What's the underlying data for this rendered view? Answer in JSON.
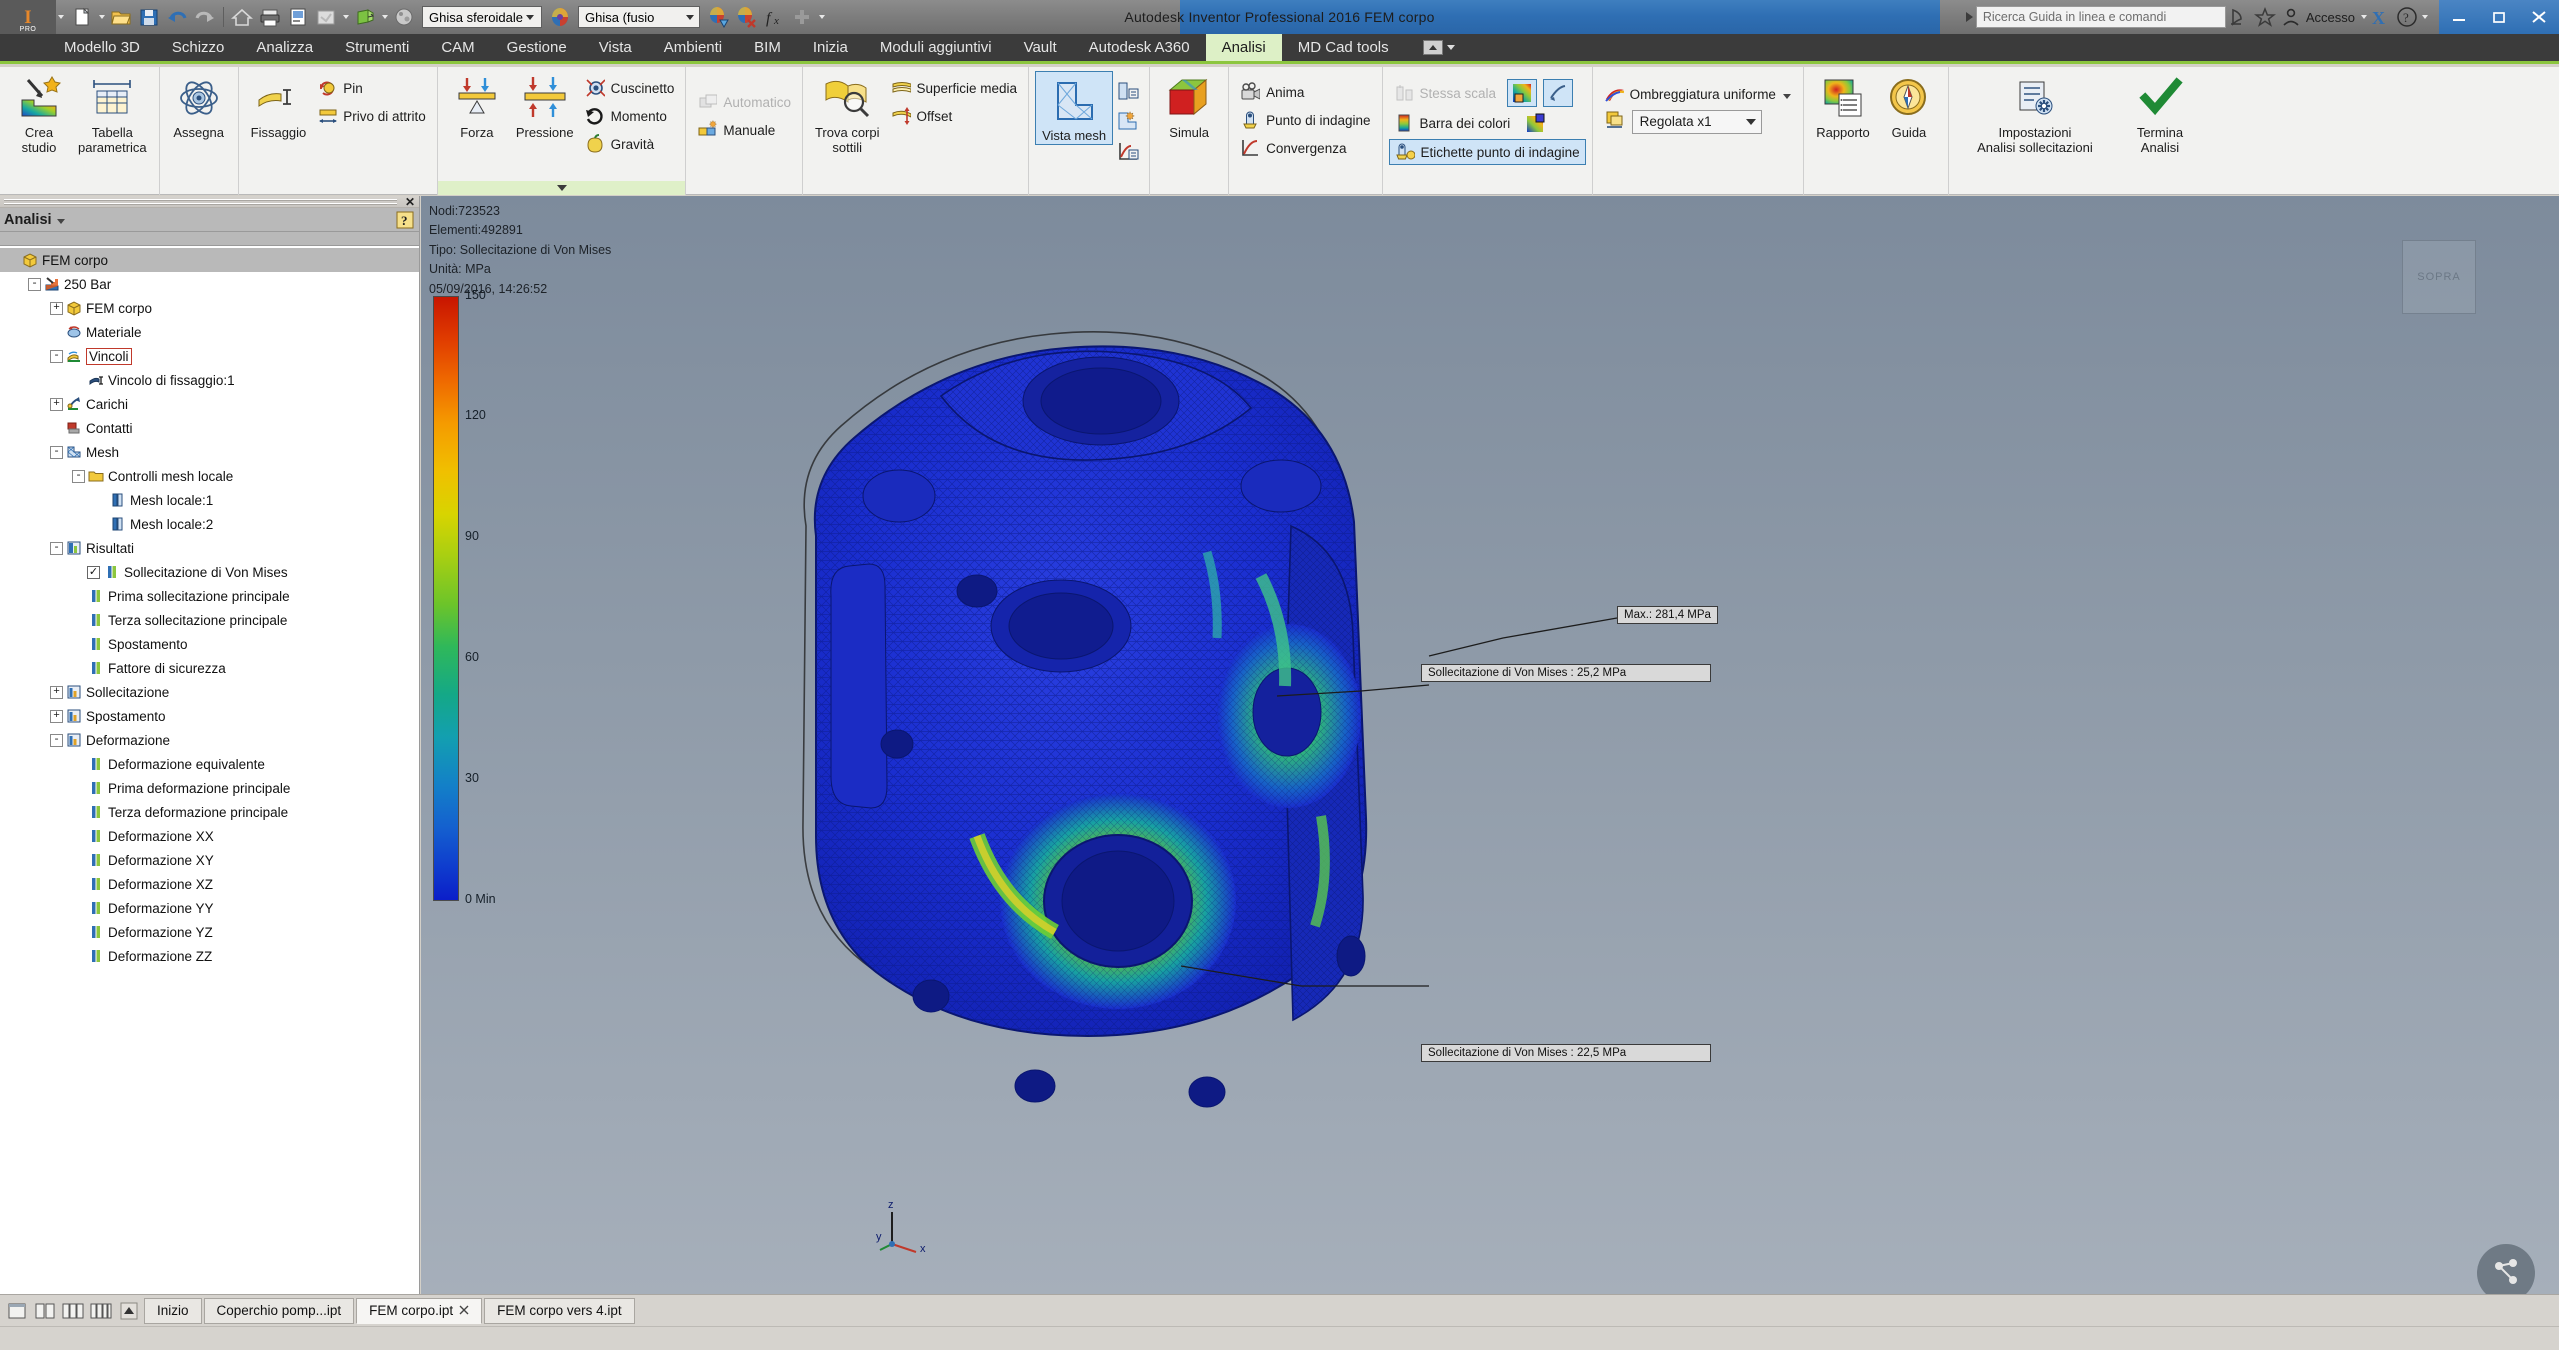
{
  "titlebar": {
    "app_badge": "I",
    "app_badge_sub": "PRO",
    "title": "Autodesk Inventor Professional 2016    FEM corpo",
    "material_combo": "Ghisa sferoidale",
    "appearance_combo": "Ghisa (fusio",
    "search_placeholder": "Ricerca Guida in linea e comandi",
    "account_label": "Accesso",
    "quick_access_icons": [
      "new-document-icon",
      "open-folder-icon",
      "save-icon",
      "undo-icon",
      "redo-icon",
      "home-icon",
      "print-icon",
      "sheet-icon",
      "update-icon",
      "return-icon",
      "material-sphere-icon"
    ],
    "window_buttons": [
      "minimize",
      "restore",
      "close"
    ]
  },
  "ribbon": {
    "tabs": [
      {
        "label": "Modello 3D",
        "active": false
      },
      {
        "label": "Schizzo",
        "active": false
      },
      {
        "label": "Analizza",
        "active": false
      },
      {
        "label": "Strumenti",
        "active": false
      },
      {
        "label": "CAM",
        "active": false
      },
      {
        "label": "Gestione",
        "active": false
      },
      {
        "label": "Vista",
        "active": false
      },
      {
        "label": "Ambienti",
        "active": false
      },
      {
        "label": "BIM",
        "active": false
      },
      {
        "label": "Inizia",
        "active": false
      },
      {
        "label": "Moduli aggiuntivi",
        "active": false
      },
      {
        "label": "Vault",
        "active": false
      },
      {
        "label": "Autodesk A360",
        "active": false
      },
      {
        "label": "Analisi",
        "active": true
      },
      {
        "label": "MD Cad tools",
        "active": false
      }
    ],
    "panels": {
      "gestisci": {
        "buttons": [
          {
            "label_line1": "Crea",
            "label_line2": "studio",
            "icon": "create-study-icon"
          },
          {
            "label_line1": "Tabella",
            "label_line2": "parametrica",
            "icon": "parametric-table-icon"
          }
        ]
      },
      "materiale": {
        "buttons": [
          {
            "label_line1": "Assegna",
            "label_line2": "",
            "icon": "assign-material-icon"
          }
        ]
      },
      "vincoli": {
        "big": {
          "label_line1": "Fissaggio",
          "label_line2": "",
          "icon": "fixed-constraint-icon"
        },
        "small": [
          {
            "label": "Pin",
            "icon": "pin-constraint-icon"
          },
          {
            "label": "Privo di attrito",
            "icon": "frictionless-constraint-icon"
          }
        ]
      },
      "carichi": {
        "big": [
          {
            "label_line1": "Forza",
            "label_line2": "",
            "icon": "force-load-icon"
          },
          {
            "label_line1": "Pressione",
            "label_line2": "",
            "icon": "pressure-load-icon"
          }
        ],
        "small": [
          {
            "label": "Cuscinetto",
            "icon": "bearing-load-icon"
          },
          {
            "label": "Momento",
            "icon": "moment-load-icon"
          },
          {
            "label": "Gravità",
            "icon": "gravity-load-icon"
          }
        ],
        "expand": true
      },
      "contatti": {
        "small": [
          {
            "label": "Automatico",
            "icon": "automatic-contact-icon",
            "disabled": true
          },
          {
            "label": "Manuale",
            "icon": "manual-contact-icon",
            "disabled": false
          }
        ]
      },
      "preparazione": {
        "big": {
          "label_line1": "Trova corpi",
          "label_line2": "sottili",
          "icon": "find-thin-bodies-icon"
        },
        "small": [
          {
            "label": "Superficie media",
            "icon": "midsurface-icon"
          },
          {
            "label": "Offset",
            "icon": "offset-icon"
          }
        ]
      },
      "mesh": {
        "big": {
          "label_line1": "Vista mesh",
          "label_line2": "",
          "icon": "mesh-view-icon",
          "selected": true
        },
        "mini": [
          {
            "icon": "local-mesh-control-icon"
          },
          {
            "icon": "mesh-settings-icon"
          },
          {
            "icon": "convergence-settings-icon"
          }
        ]
      },
      "risolvi": {
        "big": {
          "label_line1": "Simula",
          "label_line2": "",
          "icon": "simulate-icon"
        }
      },
      "risultato": {
        "small": [
          {
            "label": "Anima",
            "icon": "animate-icon"
          },
          {
            "label": "Punto di indagine",
            "icon": "probe-point-icon"
          },
          {
            "label": "Convergenza",
            "icon": "convergence-plot-icon"
          }
        ]
      },
      "visualizza": {
        "small": [
          {
            "label": "Stessa scala",
            "icon": "same-scale-icon",
            "disabled": true
          },
          {
            "label": "Barra dei colori",
            "icon": "color-bar-icon",
            "disabled": false
          },
          {
            "label": "Etichette punto di indagine",
            "icon": "probe-labels-icon",
            "selected": true
          }
        ],
        "mini": [
          {
            "icon": "max-result-icon",
            "selected": true
          },
          {
            "icon": "min-result-icon",
            "selected": true
          },
          {
            "icon": "probe-label-settings-icon",
            "selected": false
          }
        ]
      },
      "display": {
        "shading_label": "Ombreggiatura uniforme",
        "shading_icon": "smooth-shading-icon",
        "scale_icon": "deformation-scale-icon",
        "scale_value": "Regolata x1"
      },
      "report": {
        "buttons": [
          {
            "label_line1": "Rapporto",
            "label_line2": "",
            "icon": "report-icon"
          },
          {
            "label_line1": "Guida",
            "label_line2": "",
            "icon": "help-compass-icon"
          }
        ]
      },
      "impostazioni": {
        "buttons": [
          {
            "label_line1": "Impostazioni",
            "label_line2": "Analisi sollecitazioni",
            "icon": "analysis-settings-icon"
          },
          {
            "label_line1": "Termina",
            "label_line2": "Analisi",
            "icon": "finish-analysis-icon"
          }
        ]
      }
    }
  },
  "browser": {
    "title": "Analisi",
    "help_icon": "help-question-icon",
    "close_icon": "close-icon",
    "tree": [
      {
        "label": "FEM corpo",
        "level": 0,
        "icon": "part-cube-icon",
        "expander": "",
        "selected": true
      },
      {
        "label": "250 Bar",
        "level": 1,
        "icon": "simulation-study-icon",
        "expander": "-"
      },
      {
        "label": "FEM corpo",
        "level": 2,
        "icon": "part-cube-icon",
        "expander": "+"
      },
      {
        "label": "Materiale",
        "level": 2,
        "icon": "material-icon",
        "expander": ""
      },
      {
        "label": "Vincoli",
        "level": 2,
        "icon": "constraints-folder-icon",
        "expander": "-",
        "boxed": true
      },
      {
        "label": "Vincolo di fissaggio:1",
        "level": 3,
        "icon": "fixed-constraint-icon",
        "expander": ""
      },
      {
        "label": "Carichi",
        "level": 2,
        "icon": "loads-folder-icon",
        "expander": "+"
      },
      {
        "label": "Contatti",
        "level": 2,
        "icon": "contacts-folder-icon",
        "expander": ""
      },
      {
        "label": "Mesh",
        "level": 2,
        "icon": "mesh-folder-icon",
        "expander": "-"
      },
      {
        "label": "Controlli mesh locale",
        "level": 3,
        "icon": "folder-icon",
        "expander": "-"
      },
      {
        "label": "Mesh locale:1",
        "level": 4,
        "icon": "local-mesh-icon",
        "expander": ""
      },
      {
        "label": "Mesh locale:2",
        "level": 4,
        "icon": "local-mesh-icon",
        "expander": ""
      },
      {
        "label": "Risultati",
        "level": 2,
        "icon": "results-folder-icon",
        "expander": "-"
      },
      {
        "label": "Sollecitazione di Von Mises",
        "level": 3,
        "icon": "result-item-icon",
        "expander": "",
        "checked": true
      },
      {
        "label": "Prima sollecitazione principale",
        "level": 3,
        "icon": "result-item-icon",
        "expander": ""
      },
      {
        "label": "Terza sollecitazione principale",
        "level": 3,
        "icon": "result-item-icon",
        "expander": ""
      },
      {
        "label": "Spostamento",
        "level": 3,
        "icon": "result-item-icon",
        "expander": ""
      },
      {
        "label": "Fattore di sicurezza",
        "level": 3,
        "icon": "result-item-icon",
        "expander": ""
      },
      {
        "label": "Sollecitazione",
        "level": 2,
        "icon": "results-group-icon",
        "expander": "+"
      },
      {
        "label": "Spostamento",
        "level": 2,
        "icon": "results-group-icon",
        "expander": "+"
      },
      {
        "label": "Deformazione",
        "level": 2,
        "icon": "results-group-icon",
        "expander": "-"
      },
      {
        "label": "Deformazione equivalente",
        "level": 3,
        "icon": "result-item-icon",
        "expander": ""
      },
      {
        "label": "Prima deformazione principale",
        "level": 3,
        "icon": "result-item-icon",
        "expander": ""
      },
      {
        "label": "Terza deformazione principale",
        "level": 3,
        "icon": "result-item-icon",
        "expander": ""
      },
      {
        "label": "Deformazione XX",
        "level": 3,
        "icon": "result-item-icon",
        "expander": ""
      },
      {
        "label": "Deformazione XY",
        "level": 3,
        "icon": "result-item-icon",
        "expander": ""
      },
      {
        "label": "Deformazione XZ",
        "level": 3,
        "icon": "result-item-icon",
        "expander": ""
      },
      {
        "label": "Deformazione YY",
        "level": 3,
        "icon": "result-item-icon",
        "expander": ""
      },
      {
        "label": "Deformazione YZ",
        "level": 3,
        "icon": "result-item-icon",
        "expander": ""
      },
      {
        "label": "Deformazione ZZ",
        "level": 3,
        "icon": "result-item-icon",
        "expander": ""
      }
    ]
  },
  "viewport": {
    "info": {
      "nodes": "Nodi:723523",
      "elements": "Elementi:492891",
      "type": "Tipo: Sollecitazione di Von Mises",
      "unit": "Unità: MPa",
      "timestamp": "05/09/2016, 14:26:52"
    },
    "colorbar": {
      "unit": "MPa",
      "ticks": [
        "150",
        "120",
        "90",
        "60",
        "30",
        "0 Min"
      ],
      "max_value": 150,
      "min_value": 0
    },
    "annotations": [
      {
        "text": "Max.: 281,4 MPa",
        "name": "max-stress-label"
      },
      {
        "text": "Sollecitazione di Von Mises : 25,2 MPa",
        "name": "probe-label-1"
      },
      {
        "text": "Sollecitazione di Von Mises : 22,5 MPa",
        "name": "probe-label-2"
      }
    ],
    "triad": {
      "x": "x",
      "y": "y",
      "z": "z"
    },
    "navcube_label": "SOPRA"
  },
  "doctabs": {
    "view_icons": [
      "single-view-icon",
      "two-view-icon",
      "three-view-icon",
      "four-view-icon",
      "scroll-up-icon"
    ],
    "tabs": [
      {
        "label": "Inizio",
        "active": false,
        "closable": false
      },
      {
        "label": "Coperchio pomp...ipt",
        "active": false,
        "closable": false
      },
      {
        "label": "FEM corpo.ipt",
        "active": true,
        "closable": true
      },
      {
        "label": "FEM corpo vers 4.ipt",
        "active": false,
        "closable": false
      }
    ]
  },
  "colors": {
    "ribbon_accent": "#8cc63e",
    "tab_active_bg": "#ddf0c6",
    "selection_blue": "#cfe4f7",
    "selection_border": "#3c7fb1",
    "viewport_bg_top": "#7d8b9c",
    "viewport_bg_bottom": "#a7b0bb"
  }
}
